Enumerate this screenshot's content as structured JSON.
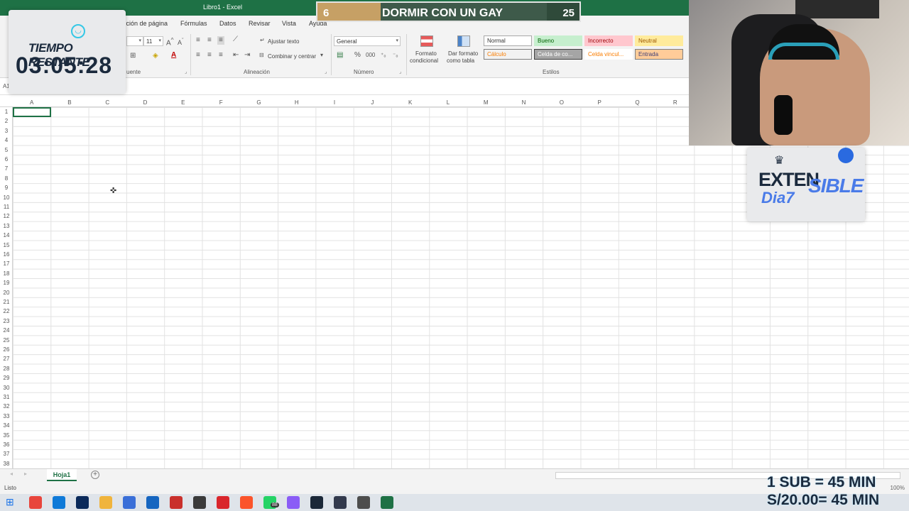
{
  "window": {
    "title": "Libro1 - Excel"
  },
  "menu": {
    "tabs": [
      "Disposición de página",
      "Fórmulas",
      "Datos",
      "Revisar",
      "Vista",
      "Ayuda"
    ]
  },
  "ribbon": {
    "font_group_label": "uente",
    "font_size": "11",
    "alignment_group_label": "Alineación",
    "wrap_text": "Ajustar texto",
    "merge_center": "Combinar y centrar",
    "number_group_label": "Número",
    "number_format": "General",
    "conditional_format": [
      "Formato",
      "condicional"
    ],
    "format_as_table": [
      "Dar formato",
      "como tabla"
    ],
    "styles_group_label": "Estilos",
    "styles": [
      {
        "label": "Normal",
        "bg": "#ffffff",
        "fg": "#333333",
        "border": "#a8a8a8"
      },
      {
        "label": "Bueno",
        "bg": "#c6efce",
        "fg": "#006100",
        "border": "#c6efce"
      },
      {
        "label": "Incorrecto",
        "bg": "#ffc7ce",
        "fg": "#9c0006",
        "border": "#ffc7ce"
      },
      {
        "label": "Neutral",
        "bg": "#ffeb9c",
        "fg": "#9c5700",
        "border": "#ffeb9c"
      },
      {
        "label": "Cálculo",
        "bg": "#f2f2f2",
        "fg": "#fa7d00",
        "border": "#7f7f7f"
      },
      {
        "label": "Celda de co...",
        "bg": "#a5a5a5",
        "fg": "#ffffff",
        "border": "#3f3f3f"
      },
      {
        "label": "Celda vincul...",
        "bg": "#ffffff",
        "fg": "#fa7d00",
        "border": "#ffffff"
      },
      {
        "label": "Entrada",
        "bg": "#ffcc99",
        "fg": "#3f3f76",
        "border": "#7f7f7f"
      }
    ]
  },
  "formula_bar": {
    "name_box": "A1"
  },
  "grid": {
    "columns": [
      "A",
      "B",
      "C",
      "D",
      "E",
      "F",
      "G",
      "H",
      "I",
      "J",
      "K",
      "L",
      "M",
      "N",
      "O",
      "P",
      "Q",
      "R"
    ],
    "rows": [
      "1",
      "2",
      "3",
      "4",
      "5",
      "6",
      "7",
      "8",
      "9",
      "10",
      "11",
      "12",
      "13",
      "14",
      "15",
      "16",
      "17",
      "18",
      "19",
      "20",
      "21",
      "22",
      "23",
      "24",
      "25",
      "26",
      "27",
      "28",
      "29",
      "30",
      "31",
      "32",
      "33",
      "34",
      "35",
      "36",
      "37",
      "38"
    ]
  },
  "sheets": {
    "active": "Hoja1"
  },
  "status": {
    "text": "Listo",
    "zoom": "100%"
  },
  "overlay": {
    "timer_label": "TIEMPO RESTANTE",
    "timer_value": "03:05:28",
    "goal_current": "6",
    "goal_title": "DORMIR CON UN GAY",
    "goal_target": "25",
    "goal_progress": 0.24,
    "event_word1": "EXTEN",
    "event_word2": "SIBLE",
    "event_day": "Dia7",
    "promo_line1": "1 SUB = 45 MIN",
    "promo_line2": "S/20.00= 45 MIN"
  },
  "taskbar": {
    "icons": [
      "windows-icon",
      "chrome-icon",
      "edge-icon",
      "photoshop-icon",
      "folder-icon",
      "store-icon",
      "mail-icon",
      "app-icon",
      "obs-icon",
      "opera-gx-icon",
      "brave-icon",
      "whatsapp-icon",
      "messenger-icon",
      "steam-icon",
      "terminal-icon",
      "calculator-icon",
      "excel-icon"
    ],
    "whatsapp_badge": "88"
  },
  "colors": {
    "excel_green": "#1e7145",
    "accent_blue": "#4a7be8"
  }
}
